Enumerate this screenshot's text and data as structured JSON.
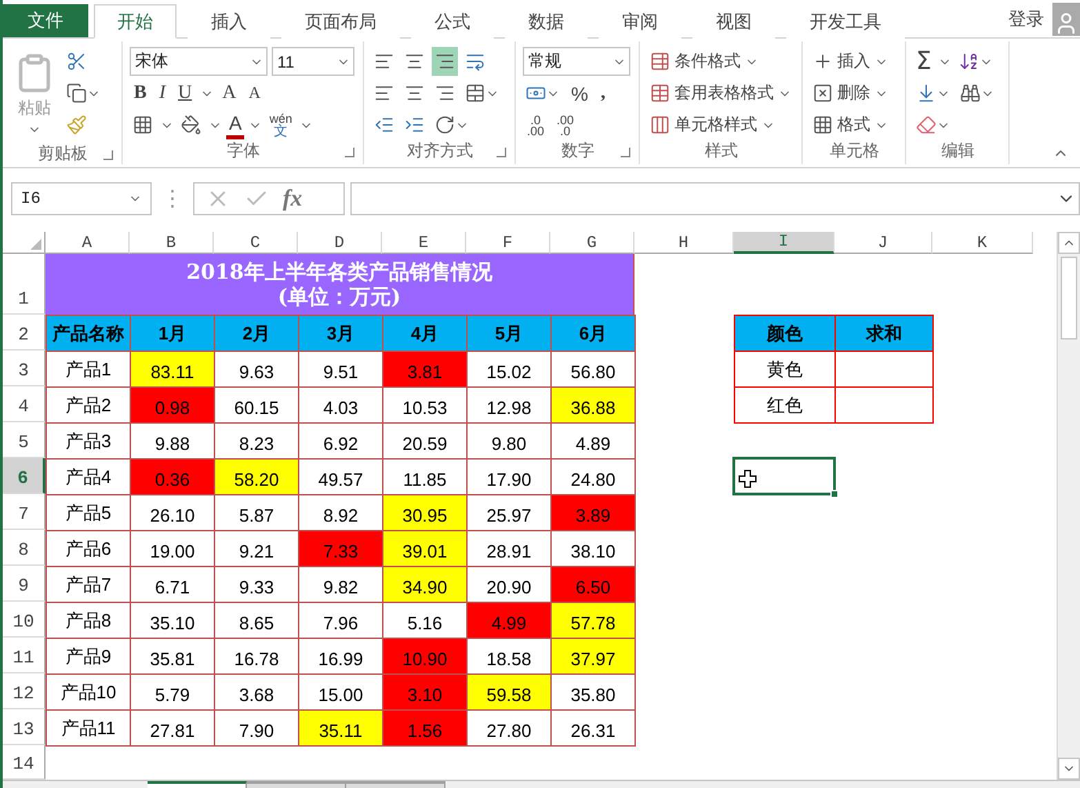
{
  "file_tab": "文件",
  "ribbon_tabs": [
    {
      "label": "开始",
      "selected": true
    },
    {
      "label": "插入",
      "selected": false
    },
    {
      "label": "页面布局",
      "selected": false
    },
    {
      "label": "公式",
      "selected": false
    },
    {
      "label": "数据",
      "selected": false
    },
    {
      "label": "审阅",
      "selected": false
    },
    {
      "label": "视图",
      "selected": false
    },
    {
      "label": "开发工具",
      "selected": false
    }
  ],
  "account": {
    "label": "登录"
  },
  "ribbon": {
    "clipboard": {
      "paste": "粘贴",
      "label": "剪贴板"
    },
    "font": {
      "name": "宋体",
      "size": "11",
      "styles": [
        "B",
        "I",
        "U"
      ],
      "grow": "A",
      "shrink": "A",
      "font_color": "A",
      "phonetic_top": "wén",
      "phonetic_bottom": "文",
      "label": "字体"
    },
    "alignment": {
      "vertical_align": [
        {
          "selected": false
        },
        {
          "selected": false
        },
        {
          "selected": true
        }
      ],
      "label": "对齐方式"
    },
    "number": {
      "format": "常规",
      "percent": "%",
      "comma": ",",
      "decimals": [
        {
          "top": ".0",
          "bottom": ".00"
        },
        {
          "top": ".00",
          "bottom": ".0"
        }
      ],
      "label": "数字"
    },
    "styles": {
      "buttons": [
        "条件格式",
        "套用表格格式",
        "单元格样式"
      ],
      "label": "样式"
    },
    "cells": {
      "buttons": [
        "插入",
        "删除",
        "格式"
      ],
      "label": "单元格"
    },
    "editing": {
      "sum": "Σ",
      "label": "编辑"
    }
  },
  "formula_bar": {
    "name_box": "I6",
    "dots": "⋮",
    "fx": "fx"
  },
  "columns": [
    {
      "label": "A",
      "selected": false
    },
    {
      "label": "B",
      "selected": false
    },
    {
      "label": "C",
      "selected": false
    },
    {
      "label": "D",
      "selected": false
    },
    {
      "label": "E",
      "selected": false
    },
    {
      "label": "F",
      "selected": false
    },
    {
      "label": "G",
      "selected": false
    },
    {
      "label": "H",
      "selected": false
    },
    {
      "label": "I",
      "selected": true
    },
    {
      "label": "J",
      "selected": false
    },
    {
      "label": "K",
      "selected": false
    }
  ],
  "row_headers": [
    {
      "label": "1",
      "selected": false
    },
    {
      "label": "2",
      "selected": false
    },
    {
      "label": "3",
      "selected": false
    },
    {
      "label": "4",
      "selected": false
    },
    {
      "label": "5",
      "selected": false
    },
    {
      "label": "6",
      "selected": true
    },
    {
      "label": "7",
      "selected": false
    },
    {
      "label": "8",
      "selected": false
    },
    {
      "label": "9",
      "selected": false
    },
    {
      "label": "10",
      "selected": false
    },
    {
      "label": "11",
      "selected": false
    },
    {
      "label": "12",
      "selected": false
    },
    {
      "label": "13",
      "selected": false
    },
    {
      "label": "14",
      "selected": false
    }
  ],
  "title_cell": {
    "lines": [
      "2018年上半年各类产品销售情况",
      "(单位：万元)"
    ]
  },
  "header_row": [
    "产品名称",
    "1月",
    "2月",
    "3月",
    "4月",
    "5月",
    "6月"
  ],
  "data_rows": [
    {
      "cells": [
        {
          "text": "产品1"
        },
        {
          "text": "83.11",
          "color": "#ffff00"
        },
        {
          "text": "9.63"
        },
        {
          "text": "9.51"
        },
        {
          "text": "3.81",
          "color": "#ff0000"
        },
        {
          "text": "15.02"
        },
        {
          "text": "56.80"
        }
      ]
    },
    {
      "cells": [
        {
          "text": "产品2"
        },
        {
          "text": "0.98",
          "color": "#ff0000"
        },
        {
          "text": "60.15"
        },
        {
          "text": "4.03"
        },
        {
          "text": "10.53"
        },
        {
          "text": "12.98"
        },
        {
          "text": "36.88",
          "color": "#ffff00"
        }
      ]
    },
    {
      "cells": [
        {
          "text": "产品3"
        },
        {
          "text": "9.88"
        },
        {
          "text": "8.23"
        },
        {
          "text": "6.92"
        },
        {
          "text": "20.59"
        },
        {
          "text": "9.80"
        },
        {
          "text": "4.89"
        }
      ]
    },
    {
      "cells": [
        {
          "text": "产品4"
        },
        {
          "text": "0.36",
          "color": "#ff0000"
        },
        {
          "text": "58.20",
          "color": "#ffff00"
        },
        {
          "text": "49.57"
        },
        {
          "text": "11.85"
        },
        {
          "text": "17.90"
        },
        {
          "text": "24.80"
        }
      ]
    },
    {
      "cells": [
        {
          "text": "产品5"
        },
        {
          "text": "26.10"
        },
        {
          "text": "5.87"
        },
        {
          "text": "8.92"
        },
        {
          "text": "30.95",
          "color": "#ffff00"
        },
        {
          "text": "25.97"
        },
        {
          "text": "3.89",
          "color": "#ff0000"
        }
      ]
    },
    {
      "cells": [
        {
          "text": "产品6"
        },
        {
          "text": "19.00"
        },
        {
          "text": "9.21"
        },
        {
          "text": "7.33",
          "color": "#ff0000"
        },
        {
          "text": "39.01",
          "color": "#ffff00"
        },
        {
          "text": "28.91"
        },
        {
          "text": "38.10"
        }
      ]
    },
    {
      "cells": [
        {
          "text": "产品7"
        },
        {
          "text": "6.71"
        },
        {
          "text": "9.33"
        },
        {
          "text": "9.82"
        },
        {
          "text": "34.90",
          "color": "#ffff00"
        },
        {
          "text": "20.90"
        },
        {
          "text": "6.50",
          "color": "#ff0000"
        }
      ]
    },
    {
      "cells": [
        {
          "text": "产品8"
        },
        {
          "text": "35.10"
        },
        {
          "text": "8.65"
        },
        {
          "text": "7.96"
        },
        {
          "text": "5.16"
        },
        {
          "text": "4.99",
          "color": "#ff0000"
        },
        {
          "text": "57.78",
          "color": "#ffff00"
        }
      ]
    },
    {
      "cells": [
        {
          "text": "产品9"
        },
        {
          "text": "35.81"
        },
        {
          "text": "16.78"
        },
        {
          "text": "16.99"
        },
        {
          "text": "10.90",
          "color": "#ff0000"
        },
        {
          "text": "18.58"
        },
        {
          "text": "37.97",
          "color": "#ffff00"
        }
      ]
    },
    {
      "cells": [
        {
          "text": "产品10"
        },
        {
          "text": "5.79"
        },
        {
          "text": "3.68"
        },
        {
          "text": "15.00"
        },
        {
          "text": "3.10",
          "color": "#ff0000"
        },
        {
          "text": "59.58",
          "color": "#ffff00"
        },
        {
          "text": "35.80"
        }
      ]
    },
    {
      "cells": [
        {
          "text": "产品11"
        },
        {
          "text": "27.81"
        },
        {
          "text": "7.90"
        },
        {
          "text": "35.11",
          "color": "#ffff00"
        },
        {
          "text": "1.56",
          "color": "#ff0000"
        },
        {
          "text": "27.80"
        },
        {
          "text": "26.31"
        }
      ]
    }
  ],
  "sheet_tabs": [
    {
      "selected": true
    },
    {
      "selected": false
    },
    {
      "selected": false
    }
  ],
  "summary_table": {
    "headers": [
      "颜色",
      "求和"
    ],
    "rows": [
      {
        "label": "黄色"
      },
      {
        "label": "红色"
      }
    ]
  }
}
